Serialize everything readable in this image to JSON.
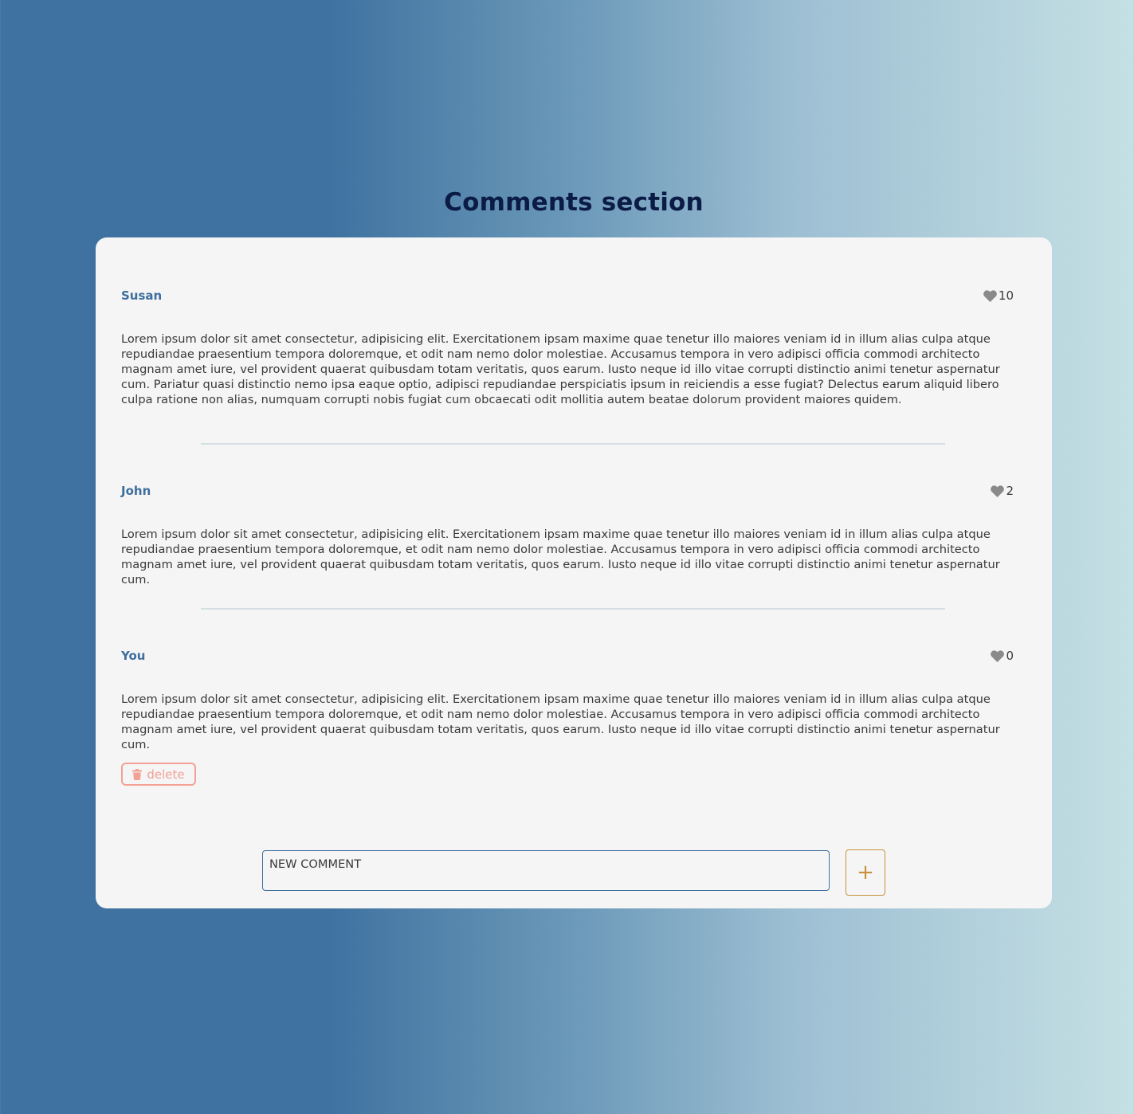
{
  "page": {
    "title": "Comments section"
  },
  "comments": [
    {
      "author": "Susan",
      "likes": "10",
      "text": "Lorem ipsum dolor sit amet consectetur, adipisicing elit. Exercitationem ipsam maxime quae tenetur illo maiores veniam id in illum alias culpa atque repudiandae praesentium tempora doloremque, et odit nam nemo dolor molestiae. Accusamus tempora in vero adipisci officia commodi architecto magnam amet iure, vel provident quaerat quibusdam totam veritatis, quos earum. Iusto neque id illo vitae corrupti distinctio animi tenetur aspernatur cum. Pariatur quasi distinctio nemo ipsa eaque optio, adipisci repudiandae perspiciatis ipsum in reiciendis a esse fugiat? Delectus earum aliquid libero culpa ratione non alias, numquam corrupti nobis fugiat cum obcaecati odit mollitia autem beatae dolorum provident maiores quidem."
    },
    {
      "author": "John",
      "likes": "2",
      "text": "Lorem ipsum dolor sit amet consectetur, adipisicing elit. Exercitationem ipsam maxime quae tenetur illo maiores veniam id in illum alias culpa atque repudiandae praesentium tempora doloremque, et odit nam nemo dolor molestiae. Accusamus tempora in vero adipisci officia commodi architecto magnam amet iure, vel provident quaerat quibusdam totam veritatis, quos earum. Iusto neque id illo vitae corrupti distinctio animi tenetur aspernatur cum."
    },
    {
      "author": "You",
      "likes": "0",
      "text": "Lorem ipsum dolor sit amet consectetur, adipisicing elit. Exercitationem ipsam maxime quae tenetur illo maiores veniam id in illum alias culpa atque repudiandae praesentium tempora doloremque, et odit nam nemo dolor molestiae. Accusamus tempora in vero adipisci officia commodi architecto magnam amet iure, vel provident quaerat quibusdam totam veritatis, quos earum. Iusto neque id illo vitae corrupti distinctio animi tenetur aspernatur cum."
    }
  ],
  "actions": {
    "delete_label": "delete",
    "add_label": "+"
  },
  "new_comment": {
    "placeholder": "NEW COMMENT",
    "value": ""
  },
  "icons": {
    "like": "heart-icon",
    "delete": "trash-icon"
  },
  "colors": {
    "background_start": "#3f72a0",
    "background_end": "#c5e0e4",
    "title": "#0b1b45",
    "author": "#3e6e9d",
    "heart": "#8a8a8a",
    "delete": "#f3a195",
    "add_button": "#c8923c",
    "card": "#f5f5f5"
  }
}
